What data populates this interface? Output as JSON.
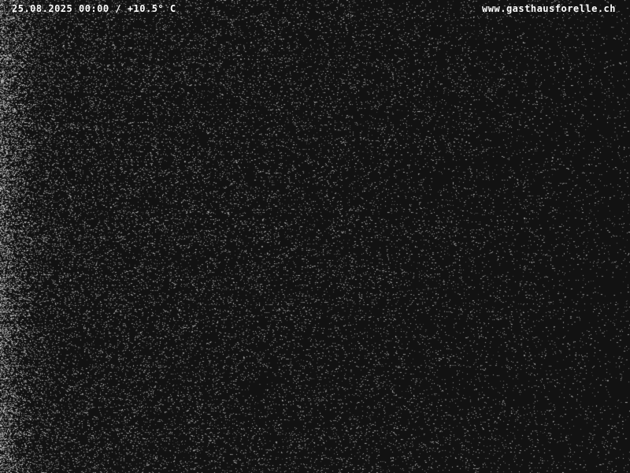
{
  "webcam": {
    "timestamp": "25.08.2025 00:00",
    "separator": "/",
    "temperature": "+10.5° C",
    "website": "www.gasthausforelle.ch"
  },
  "colors": {
    "background": "#121212",
    "noise": "#cfcfcf",
    "text": "#ffffff"
  }
}
